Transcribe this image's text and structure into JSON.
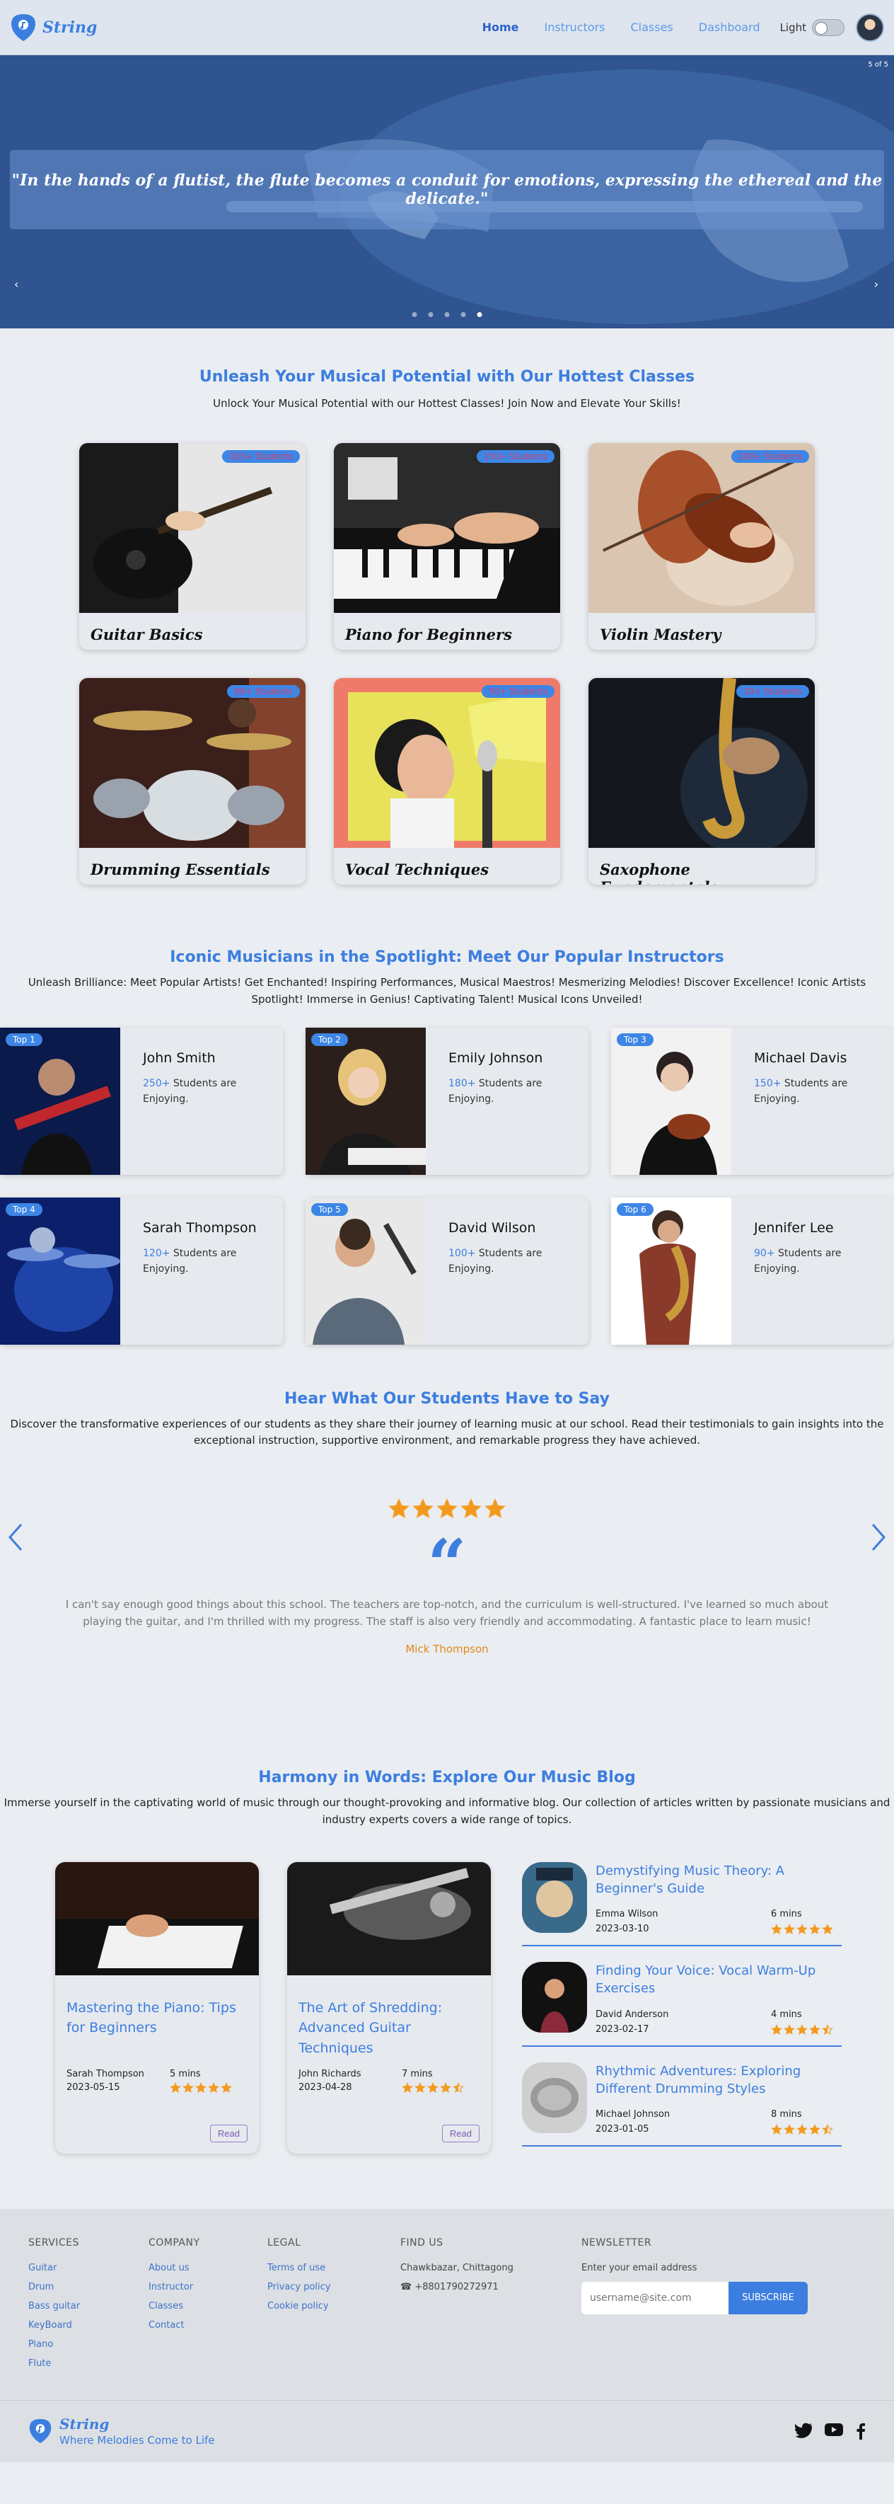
{
  "brand": {
    "name": "String",
    "tagline": "Where Melodies Come to Life"
  },
  "nav": {
    "links": [
      "Home",
      "Instructors",
      "Classes",
      "Dashboard"
    ],
    "active": "Home",
    "theme_label": "Light"
  },
  "hero": {
    "counter": "5 of 5",
    "quote": "\"In the hands of a flutist, the flute becomes a conduit for emotions, expressing the ethereal and the delicate.\"",
    "prev": "‹",
    "next": "›",
    "slides": 5,
    "active_slide": 5
  },
  "classes": {
    "title": "Unleash Your Musical Potential with Our Hottest Classes",
    "subtitle": "Unlock Your Musical Potential with our Hottest Classes! Join Now and Elevate Your Skills!",
    "items": [
      {
        "name": "Guitar Basics",
        "students": "163+ Students"
      },
      {
        "name": "Piano for Beginners",
        "students": "150+ Students"
      },
      {
        "name": "Violin Mastery",
        "students": "100+ Students"
      },
      {
        "name": "Drumming Essentials",
        "students": "80+ Students"
      },
      {
        "name": "Vocal Techniques",
        "students": "50+ Students"
      },
      {
        "name": "Saxophone Fundamentals",
        "students": "30+ Students"
      }
    ]
  },
  "instructors": {
    "title": "Iconic Musicians in the Spotlight: Meet Our Popular Instructors",
    "subtitle": "Unleash Brilliance: Meet Popular Artists! Get Enchanted! Inspiring Performances, Musical Maestros! Mesmerizing Melodies! Discover Excellence! Iconic Artists Spotlight! Immerse in Genius! Captivating Talent! Musical Icons Unveiled!",
    "suffix": "Students are Enjoying.",
    "items": [
      {
        "rank": "Top 1",
        "name": "John Smith",
        "count": "250+"
      },
      {
        "rank": "Top 2",
        "name": "Emily Johnson",
        "count": "180+"
      },
      {
        "rank": "Top 3",
        "name": "Michael Davis",
        "count": "150+"
      },
      {
        "rank": "Top 4",
        "name": "Sarah Thompson",
        "count": "120+"
      },
      {
        "rank": "Top 5",
        "name": "David Wilson",
        "count": "100+"
      },
      {
        "rank": "Top 6",
        "name": "Jennifer Lee",
        "count": "90+"
      }
    ]
  },
  "testimonials": {
    "title": "Hear What Our Students Have to Say",
    "subtitle": "Discover the transformative experiences of our students as they share their journey of learning music at our school. Read their testimonials to gain insights into the exceptional instruction, supportive environment, and remarkable progress they have achieved.",
    "rating": 5,
    "text": "I can't say enough good things about this school. The teachers are top-notch, and the curriculum is well-structured. I've learned so much about playing the guitar, and I'm thrilled with my progress. The staff is also very friendly and accommodating. A fantastic place to learn music!",
    "author": "Mick Thompson"
  },
  "blog": {
    "title": "Harmony in Words: Explore Our Music Blog",
    "subtitle": "Immerse yourself in the captivating world of music through our thought-provoking and informative blog. Our collection of articles written by passionate musicians and industry experts covers a wide range of topics.",
    "read_label": "Read",
    "cards": [
      {
        "title": "Mastering the Piano: Tips for Beginners",
        "author": "Sarah Thompson",
        "date": "2023-05-15",
        "read_time": "5 mins",
        "rating": 5
      },
      {
        "title": "The Art of Shredding: Advanced Guitar Techniques",
        "author": "John Richards",
        "date": "2023-04-28",
        "read_time": "7 mins",
        "rating": 4.5
      }
    ],
    "side": [
      {
        "title": "Demystifying Music Theory: A Beginner's Guide",
        "author": "Emma Wilson",
        "date": "2023-03-10",
        "read_time": "6 mins",
        "rating": 5
      },
      {
        "title": "Finding Your Voice: Vocal Warm-Up Exercises",
        "author": "David Anderson",
        "date": "2023-02-17",
        "read_time": "4 mins",
        "rating": 4.5
      },
      {
        "title": "Rhythmic Adventures: Exploring Different Drumming Styles",
        "author": "Michael Johnson",
        "date": "2023-01-05",
        "read_time": "8 mins",
        "rating": 4.5
      }
    ]
  },
  "footer": {
    "services": {
      "heading": "SERVICES",
      "items": [
        "Guitar",
        "Drum",
        "Bass guitar",
        "KeyBoard",
        "Piano",
        "Flute"
      ]
    },
    "company": {
      "heading": "COMPANY",
      "items": [
        "About us",
        "Instructor",
        "Classes",
        "Contact"
      ]
    },
    "legal": {
      "heading": "LEGAL",
      "items": [
        "Terms of use",
        "Privacy policy",
        "Cookie policy"
      ]
    },
    "find": {
      "heading": "FIND US",
      "address": "Chawkbazar, Chittagong",
      "phone": "+8801790272971"
    },
    "newsletter": {
      "heading": "NEWSLETTER",
      "label": "Enter your email address",
      "placeholder": "username@site.com",
      "button": "SUBSCRIBE"
    },
    "socials": [
      "twitter-icon",
      "youtube-icon",
      "facebook-icon"
    ]
  },
  "colors": {
    "accent": "#3c7ee0",
    "star": "#f39a1e",
    "hero": "#2d518e"
  }
}
